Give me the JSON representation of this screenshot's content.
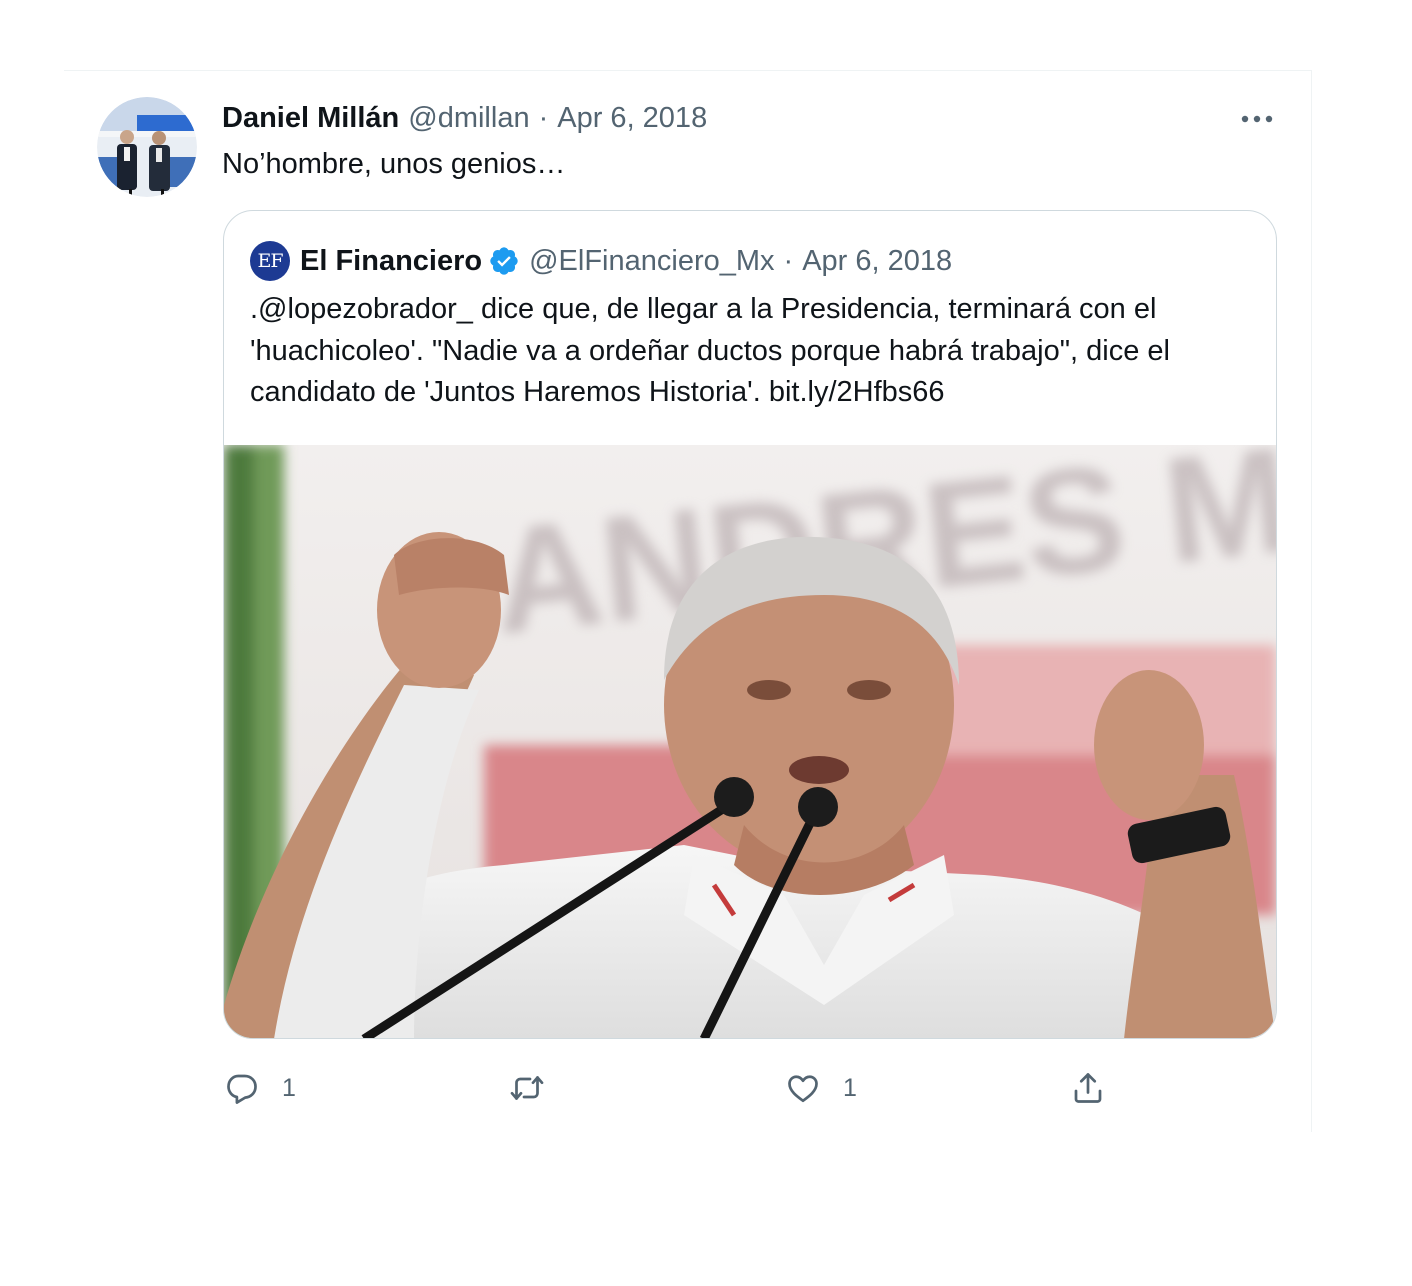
{
  "tweet": {
    "author_name": "Daniel Millán",
    "author_handle": "@dmillan",
    "separator": "·",
    "date": "Apr 6, 2018",
    "text": "No’hombre, unos genios…",
    "avatar_icon": "user-photo-avatar",
    "more_icon": "more-dots-icon"
  },
  "quote": {
    "avatar_text": "EF",
    "author_name": "El Financiero",
    "verified_icon": "verified-badge-icon",
    "verified_color": "#1d9bf0",
    "author_handle": "@ElFinanciero_Mx",
    "separator": "·",
    "date": "Apr 6, 2018",
    "text_lines": [
      ".@lopezobrador_ dice que, de llegar a la Presidencia, terminará con el",
      "'huachicoleo'. \"Nadie va a ordeñar ductos porque habrá trabajo\", dice el",
      "candidato de 'Juntos Haremos Historia'. bit.ly/2Hfbs66"
    ],
    "image_banner_text": "ANDRES M"
  },
  "actions": {
    "reply": {
      "icon": "reply-icon",
      "count": "1"
    },
    "retweet": {
      "icon": "retweet-icon",
      "count": ""
    },
    "like": {
      "icon": "heart-icon",
      "count": "1"
    },
    "share": {
      "icon": "share-icon"
    }
  },
  "colors": {
    "text_primary": "#0f1419",
    "text_secondary": "#536471",
    "border": "#cfd9de"
  }
}
